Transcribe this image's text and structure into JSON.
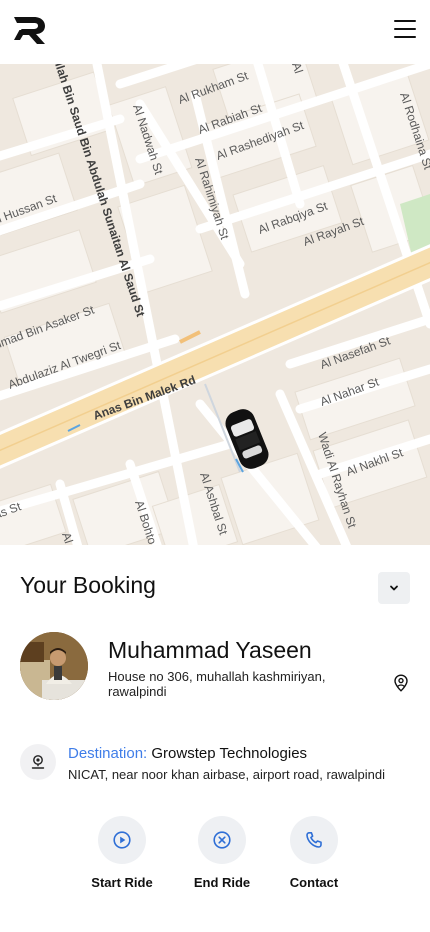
{
  "header": {
    "logo_icon": "r-logo-icon",
    "menu_icon": "hamburger-menu-icon"
  },
  "map": {
    "streets": {
      "al_rukham": "Al Rukham St",
      "al_rabiah": "Al Rabiah St",
      "al_rashediyah": "Al Rashediyah St",
      "al_rodhaina": "Al Rodhaina St",
      "al_nadwah": "Al Nadwah St",
      "al_rahimiyah": "Al Rahimiyah St",
      "al_rabqiya": "Al Rabqiya St",
      "al_rayah": "Al Rayah St",
      "hussan": "n Hussan St",
      "bin_saud": "llah Bin Saud Bin Abdulah Sunaitan Al Saud St",
      "bin_asaker": "hmad Bin Asaker St",
      "al_twegri": "Abdulaziz Al Twegri St",
      "anas": "Anas Bin Malek Rd",
      "al_nasefah": "Al Nasefah St",
      "al_nahar": "Al Nahar St",
      "wadi_rayhan": "Wadi Al Rayhan St",
      "al_nakhl": "Al Nakhl St",
      "al_ashbal": "Al Ashbal St",
      "al_bohto": "Al Bohto",
      "as_st": "as St",
      "al_frag": "Al",
      "top_frag": "Al"
    }
  },
  "booking": {
    "title": "Your Booking",
    "collapse_icon": "chevron-down-icon",
    "rider": {
      "name": "Muhammad Yaseen",
      "address": "House no 306, muhallah kashmiriyan, rawalpindi",
      "location_icon": "location-pin-icon"
    },
    "destination": {
      "label": "Destination:",
      "name": "Growstep Technologies",
      "address": "NICAT, near noor khan airbase, airport road, rawalpindi",
      "icon": "destination-pin-icon"
    },
    "actions": [
      {
        "label": "Start Ride",
        "icon": "play-icon"
      },
      {
        "label": "End Ride",
        "icon": "cancel-icon"
      },
      {
        "label": "Contact",
        "icon": "phone-icon"
      }
    ],
    "colors": {
      "accent": "#3f7de8",
      "button_bg": "#eef0f3"
    }
  }
}
